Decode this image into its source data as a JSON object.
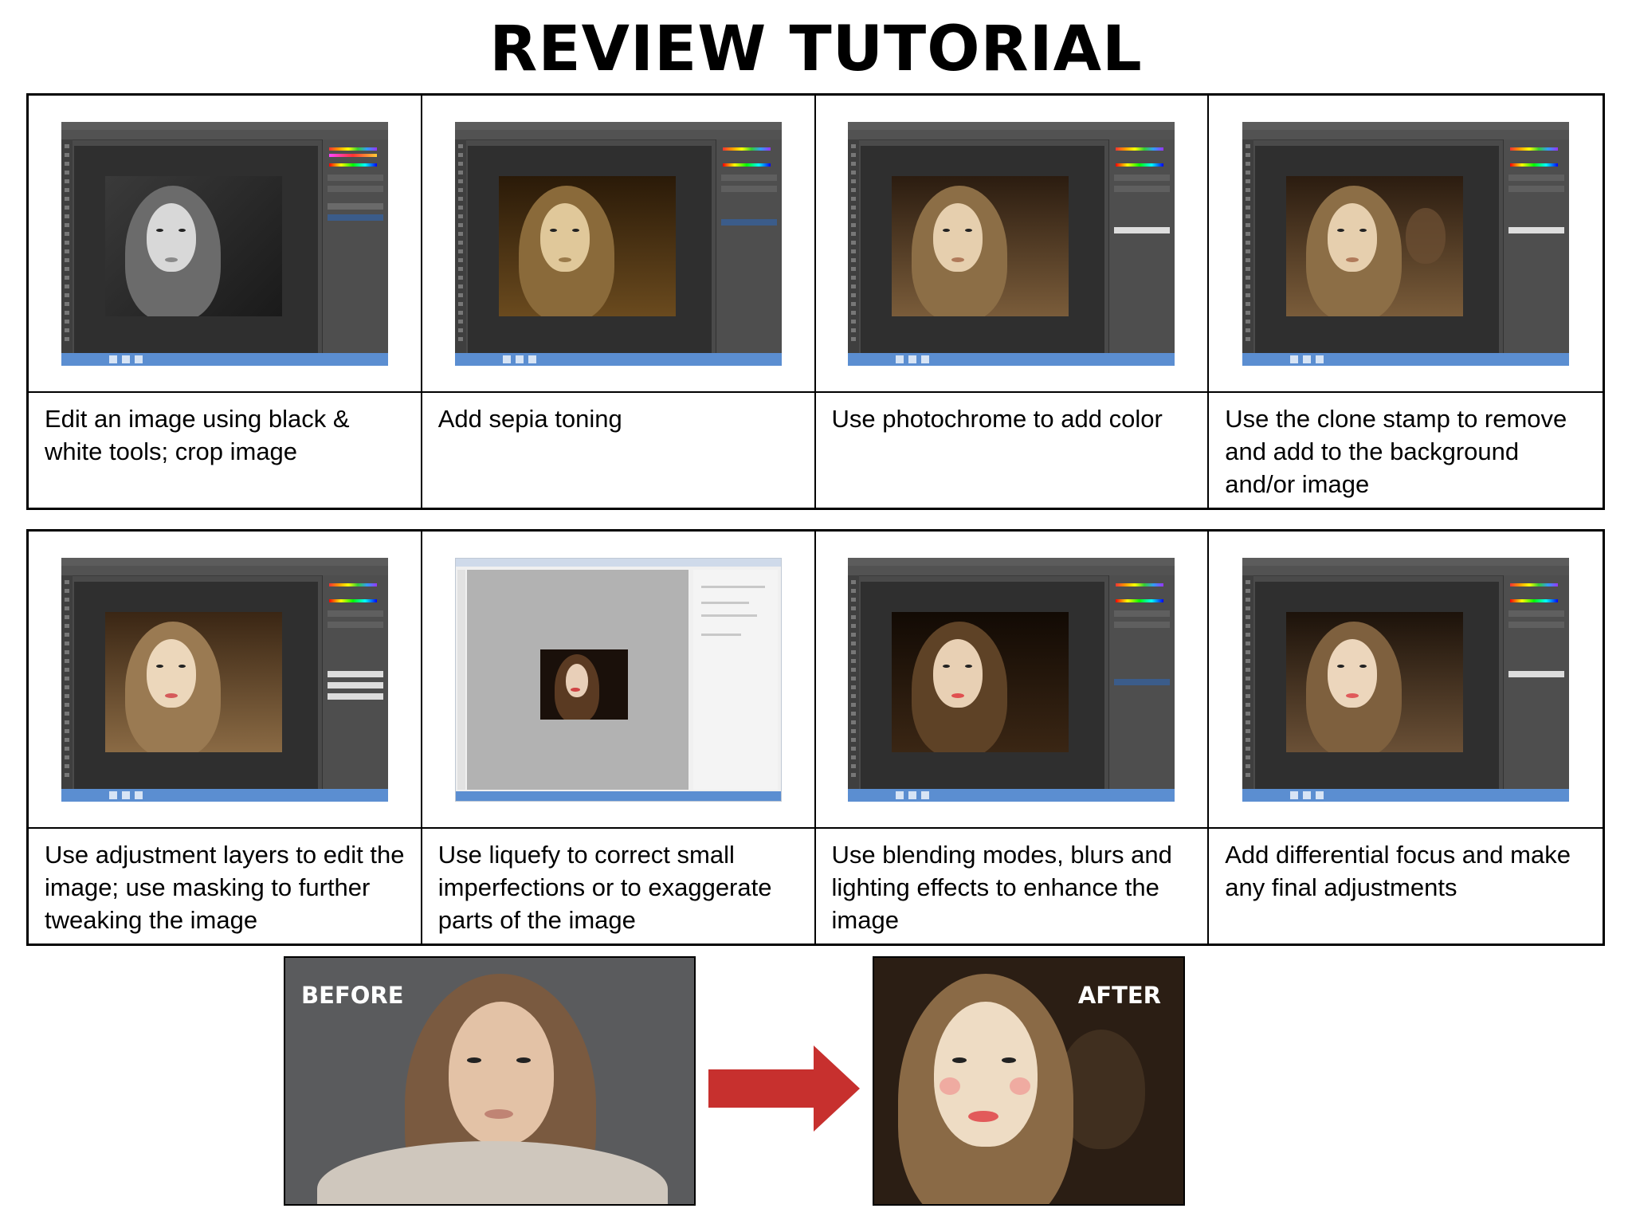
{
  "title": "REVIEW TUTORIAL",
  "row1": [
    {
      "caption": "Edit an image using black & white tools; crop image",
      "tone": "bw"
    },
    {
      "caption": "Add sepia toning",
      "tone": "sepia"
    },
    {
      "caption": "Use photochrome to add color",
      "tone": "photochrome"
    },
    {
      "caption": "Use the clone stamp to remove and add to the background and/or image",
      "tone": "clone"
    }
  ],
  "row2": [
    {
      "caption": "Use adjustment layers to edit the image; use masking to further tweaking the image",
      "tone": "adjust"
    },
    {
      "caption": "Use liquefy to correct small imperfections or to exaggerate parts of the image",
      "tone": "liquify"
    },
    {
      "caption": "Use blending modes, blurs and lighting effects to enhance the image",
      "tone": "blend"
    },
    {
      "caption": "Add differential focus and make any final adjustments",
      "tone": "focus"
    }
  ],
  "before_label": "BEFORE",
  "after_label": "AFTER",
  "colors": {
    "arrow": "#c7302e",
    "taskbar": "#5b8ed1"
  }
}
